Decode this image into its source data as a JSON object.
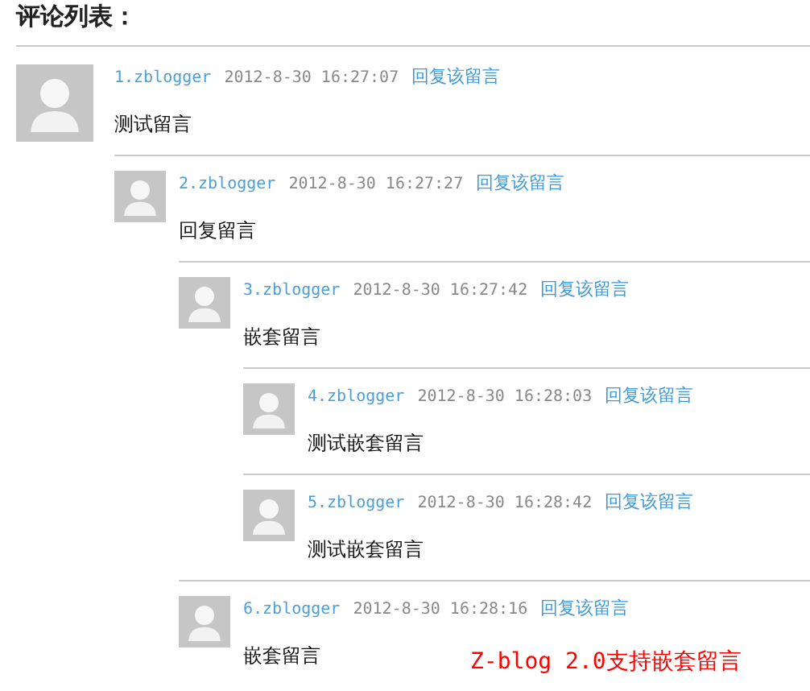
{
  "heading": "评论列表：",
  "comments": [
    {
      "number": "1.zblogger",
      "time": "2012-8-30 16:27:07",
      "reply": "回复该留言",
      "text": "测试留言",
      "children": [
        {
          "number": "2.zblogger",
          "time": "2012-8-30 16:27:27",
          "reply": "回复该留言",
          "text": "回复留言",
          "children": [
            {
              "number": "3.zblogger",
              "time": "2012-8-30 16:27:42",
              "reply": "回复该留言",
              "text": "嵌套留言",
              "children": [
                {
                  "number": "4.zblogger",
                  "time": "2012-8-30 16:28:03",
                  "reply": "回复该留言",
                  "text": "测试嵌套留言"
                },
                {
                  "number": "5.zblogger",
                  "time": "2012-8-30 16:28:42",
                  "reply": "回复该留言",
                  "text": "测试嵌套留言"
                }
              ]
            },
            {
              "number": "6.zblogger",
              "time": "2012-8-30 16:28:16",
              "reply": "回复该留言",
              "text": "嵌套留言"
            }
          ]
        }
      ]
    }
  ],
  "annotation": "Z-blog 2.0支持嵌套留言"
}
